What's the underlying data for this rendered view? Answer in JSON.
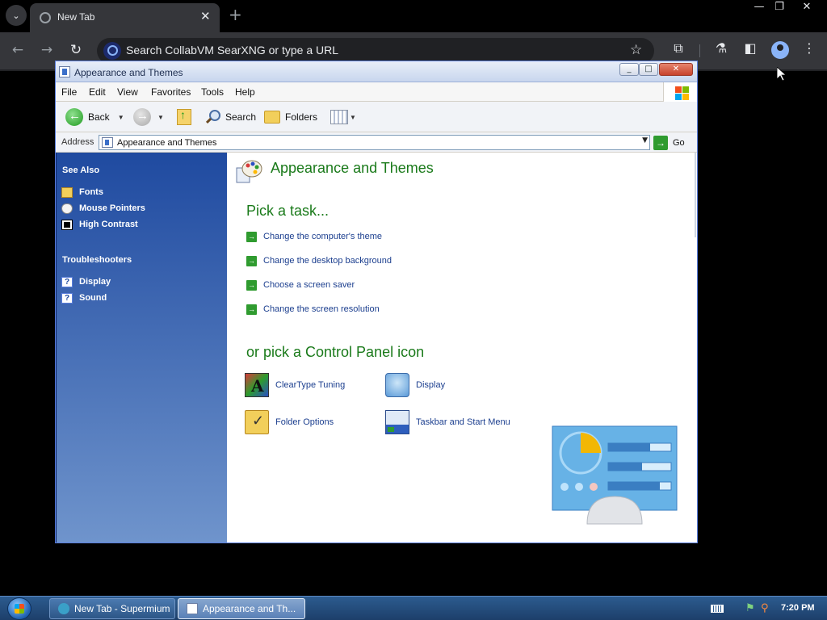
{
  "browser": {
    "tab_title": "New Tab",
    "tab_close": "✕",
    "new_tab": "+",
    "omnibox_placeholder": "Search CollabVM SearXNG or type a URL",
    "window_min": "—",
    "window_max": "❐",
    "window_close": "✕"
  },
  "xp_window": {
    "title": "Appearance and Themes",
    "menu": [
      "File",
      "Edit",
      "View",
      "Favorites",
      "Tools",
      "Help"
    ],
    "toolbar": {
      "back": "Back",
      "search": "Search",
      "folders": "Folders"
    },
    "address": {
      "label": "Address",
      "value": "Appearance and Themes",
      "go": "Go"
    },
    "left_pane": {
      "see_also_heading": "See Also",
      "see_also": [
        "Fonts",
        "Mouse Pointers",
        "High Contrast"
      ],
      "troubleshooters_heading": "Troubleshooters",
      "troubleshooters": [
        "Display",
        "Sound"
      ]
    },
    "content": {
      "title": "Appearance and Themes",
      "pick_task": "Pick a task...",
      "tasks": [
        "Change the computer's theme",
        "Change the desktop background",
        "Choose a screen saver",
        "Change the screen resolution"
      ],
      "pick_icon": "or pick a Control Panel icon",
      "icons": [
        "ClearType Tuning",
        "Display",
        "Folder Options",
        "Taskbar and Start Menu"
      ]
    }
  },
  "taskbar": {
    "buttons": [
      "New Tab - Supermium",
      "Appearance and Th..."
    ],
    "clock": "7:20 PM"
  },
  "colors": {
    "xp_green": "#1a7a1a",
    "xp_link": "#1c3f8f",
    "pane_blue": "#1f4aa0"
  }
}
